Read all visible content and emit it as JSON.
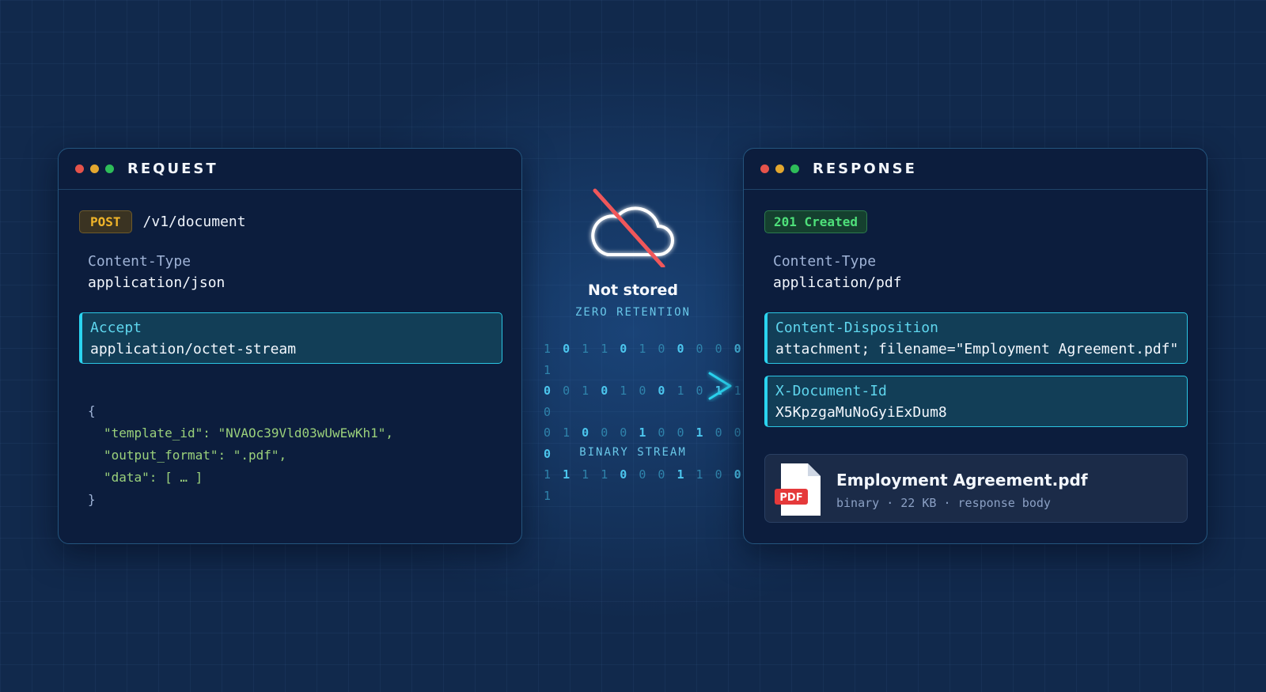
{
  "colors": {
    "background": "#11294c",
    "panel": "#0c1d3d",
    "accent_cyan": "#2bd4f0",
    "method_badge": "#f0b429",
    "status_green": "#4ee07a",
    "cloud_strike": "#f0575a",
    "pdf_red": "#e5393a"
  },
  "icons": [
    "window-dot-red",
    "window-dot-yellow",
    "window-dot-green",
    "cloud-off-icon",
    "chevron-right-icon",
    "pdf-file-icon"
  ],
  "request": {
    "title": "REQUEST",
    "method": "POST",
    "path": "/v1/document",
    "content_type": {
      "name": "Content-Type",
      "value": "application/json"
    },
    "accept": {
      "name": "Accept",
      "value": "application/octet-stream"
    },
    "body": {
      "open": "{",
      "line1": "\"template_id\": \"NVAOc39Vld03wUwEwKh1\",",
      "line2": "\"output_format\": \".pdf\",",
      "line3": "\"data\": [ … ]",
      "close": "}"
    }
  },
  "center": {
    "not_stored": "Not stored",
    "zero_retention": "ZERO RETENTION",
    "binary_rows": [
      "1 0 1 1 0 1 0 0 0 0 0 1",
      "0 0 1 0 1 0 0 1 0 1 1 0",
      "0 1 0 0 0 1 0 0 1 0 0 0",
      "1 1 1 1 0 0 0 1 1 0 0 1"
    ],
    "binary_label": "BINARY STREAM"
  },
  "response": {
    "title": "RESPONSE",
    "status": "201 Created",
    "content_type": {
      "name": "Content-Type",
      "value": "application/pdf"
    },
    "content_disposition": {
      "name": "Content-Disposition",
      "value": "attachment; filename=\"Employment Agreement.pdf\""
    },
    "document_id": {
      "name": "X-Document-Id",
      "value": "X5KpzgaMuNoGyiExDum8"
    },
    "file": {
      "badge": "PDF",
      "name": "Employment Agreement.pdf",
      "meta": "binary · 22 KB · response body"
    }
  }
}
